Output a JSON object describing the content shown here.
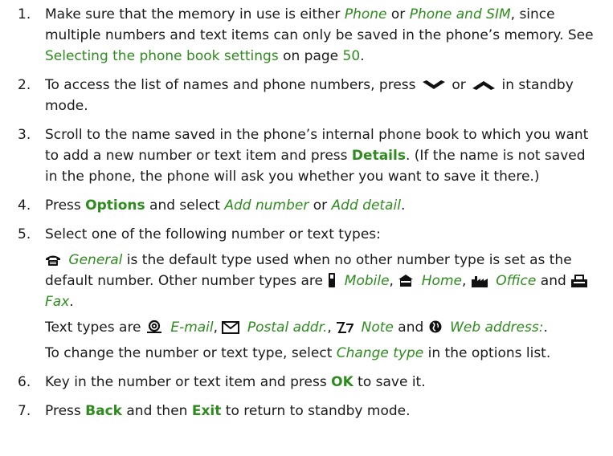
{
  "colors": {
    "text": "#1a1a1a",
    "highlight": "#2e8b1e"
  },
  "steps": [
    {
      "num": "1.",
      "t1": "Make sure that the memory in use is either ",
      "i1": "Phone",
      "t2": " or ",
      "i2": "Phone and SIM",
      "t3": ", since multiple numbers and text items can only be saved in the phone’s memory. See ",
      "link": "Selecting the phone book settings",
      "t4": " on page ",
      "page": "50",
      "t5": "."
    },
    {
      "num": "2.",
      "t1": "To access the list of names and phone numbers, press ",
      "down_icon": "scroll-down-icon",
      "t2": " or ",
      "up_icon": "scroll-up-icon",
      "t3": " in standby mode."
    },
    {
      "num": "3.",
      "t1": "Scroll to the name saved in the phone’s internal phone book to which you want to add a new number or text item and press ",
      "k1": "Details",
      "t2": ". (If the name is not saved in the phone, the phone will ask you whether you want to save it there.)"
    },
    {
      "num": "4.",
      "t1": "Press ",
      "k1": "Options",
      "t2": " and select ",
      "i1": "Add number",
      "t3": " or ",
      "i2": "Add detail",
      "t4": "."
    },
    {
      "num": "5.",
      "t1": "Select one of the following number or text types:",
      "general": "General",
      "general_text": " is the default type used when no other number type is set as the default number. Other number types are ",
      "mobile": "Mobile",
      "home": "Home",
      "office": "Office",
      "and": " and ",
      "fax": "Fax",
      "end": ".",
      "text_types": "Text types are ",
      "email": "E-mail",
      "postal": "Postal addr.",
      "note": "Note",
      "web": "Web address:",
      "change1": "To change the number or text type, select ",
      "change_type": "Change type",
      "change2": " in the options list."
    },
    {
      "num": "6.",
      "t1": "Key in the number or text item and press ",
      "k1": "OK",
      "t2": " to save it."
    },
    {
      "num": "7.",
      "t1": "Press ",
      "k1": "Back",
      "t2": " and then ",
      "k2": "Exit",
      "t3": " to return to standby mode."
    }
  ],
  "icons": [
    "telephone-icon",
    "mobile-phone-icon",
    "home-icon",
    "office-icon",
    "fax-icon",
    "email-icon",
    "postal-address-icon",
    "note-icon",
    "web-address-icon"
  ]
}
